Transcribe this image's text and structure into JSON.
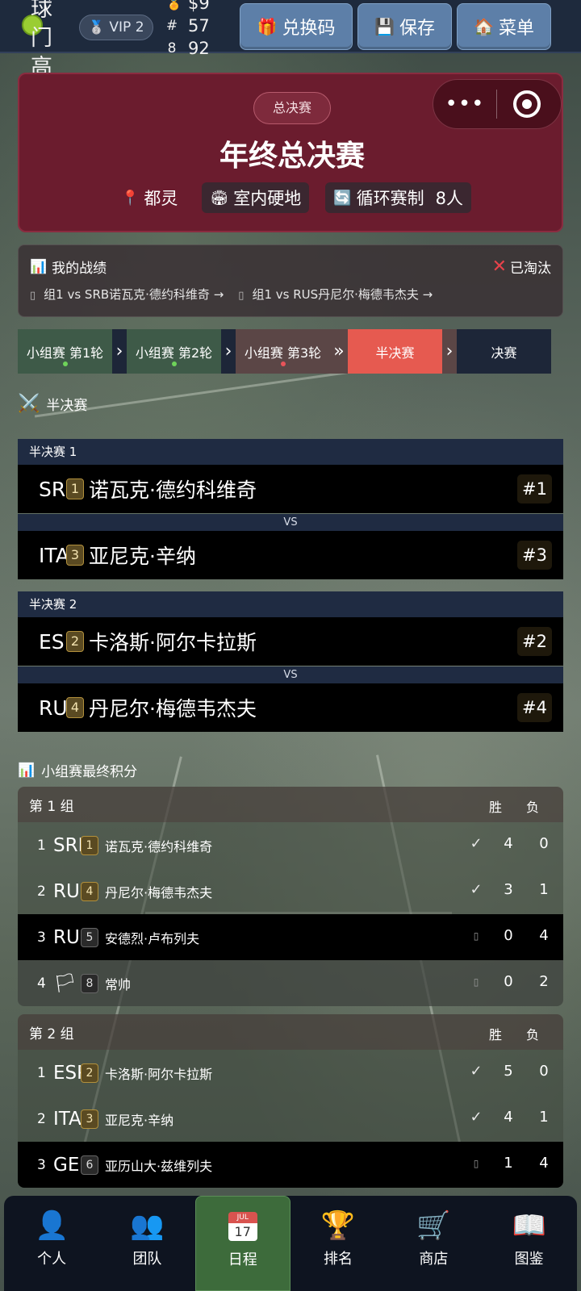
{
  "topbar": {
    "logo_text": "球\n门\n高",
    "vip_label": "VIP 2",
    "stats": [
      {
        "icon": "$",
        "value": "$9"
      },
      {
        "icon": "#",
        "value": "57"
      },
      {
        "icon": "8",
        "value": "92"
      }
    ],
    "buttons": [
      {
        "label": "兑换码",
        "icon": "gift-icon"
      },
      {
        "label": "保存",
        "icon": "floppy-disk-icon"
      },
      {
        "label": "菜单",
        "icon": "house-icon"
      }
    ]
  },
  "hero": {
    "badge": "总决赛",
    "title": "年终总决赛",
    "location": "都灵",
    "surface": "室内硬地",
    "format": "循环赛制",
    "players": "8人",
    "capsule_more": "•••"
  },
  "record": {
    "title": "我的战绩",
    "status": "已淘汰",
    "links": [
      {
        "glyph": "▯",
        "text": "组1 vs SRB诺瓦克·德约科维奇 →"
      },
      {
        "glyph": "▯",
        "text": "组1 vs RUS丹尼尔·梅德韦杰夫 →"
      }
    ]
  },
  "tabs": [
    {
      "label": "小组赛 第1轮",
      "state": "done",
      "dot": "#6fd35a"
    },
    {
      "label": "小组赛 第2轮",
      "state": "done",
      "dot": "#6fd35a"
    },
    {
      "label": "小组赛 第3轮",
      "state": "lost",
      "dot": "#e8545a"
    },
    {
      "label": "半决赛",
      "state": "active"
    },
    {
      "label": "决赛",
      "state": "future"
    }
  ],
  "tab_arrows": [
    "›",
    "›",
    "»",
    "›"
  ],
  "semifinals": {
    "title": "半决赛",
    "matches": [
      {
        "label": "半决赛 1",
        "p1": {
          "flag": "SRB",
          "seed": "1",
          "name": "诺瓦克·德约科维奇",
          "rank": "#1"
        },
        "vs": "VS",
        "p2": {
          "flag": "ITA",
          "seed": "3",
          "name": "亚尼克·辛纳",
          "rank": "#3"
        }
      },
      {
        "label": "半决赛 2",
        "p1": {
          "flag": "ESP",
          "seed": "2",
          "name": "卡洛斯·阿尔卡拉斯",
          "rank": "#2"
        },
        "vs": "VS",
        "p2": {
          "flag": "RUS",
          "seed": "4",
          "name": "丹尼尔·梅德韦杰夫",
          "rank": "#4"
        }
      }
    ]
  },
  "standings": {
    "title": "小组赛最终积分",
    "win_label": "胜",
    "loss_label": "负",
    "groups": [
      {
        "name": "第 1 组",
        "rows": [
          {
            "pos": "1",
            "flag": "SRB",
            "seed": "1",
            "name": "诺瓦克·德约科维奇",
            "mark": "✓",
            "w": "4",
            "l": "0",
            "state": "qual"
          },
          {
            "pos": "2",
            "flag": "RUS",
            "seed": "4",
            "name": "丹尼尔·梅德韦杰夫",
            "mark": "✓",
            "w": "3",
            "l": "1",
            "state": "qual"
          },
          {
            "pos": "3",
            "flag": "RUS",
            "seed": "5",
            "name": "安德烈·卢布列夫",
            "mark": "▯",
            "w": "0",
            "l": "4",
            "state": "out"
          },
          {
            "pos": "4",
            "flag": "🏳",
            "seed": "8",
            "name": "常帅",
            "mark": "▯",
            "w": "0",
            "l": "2",
            "state": "other"
          }
        ]
      },
      {
        "name": "第 2 组",
        "rows": [
          {
            "pos": "1",
            "flag": "ESP",
            "seed": "2",
            "name": "卡洛斯·阿尔卡拉斯",
            "mark": "✓",
            "w": "5",
            "l": "0",
            "state": "qual"
          },
          {
            "pos": "2",
            "flag": "ITA",
            "seed": "3",
            "name": "亚尼克·辛纳",
            "mark": "✓",
            "w": "4",
            "l": "1",
            "state": "qual"
          },
          {
            "pos": "3",
            "flag": "GER",
            "seed": "6",
            "name": "亚历山大·兹维列夫",
            "mark": "▯",
            "w": "1",
            "l": "4",
            "state": "out"
          }
        ]
      }
    ]
  },
  "nav": [
    {
      "label": "个人",
      "icon": "person-icon"
    },
    {
      "label": "团队",
      "icon": "team-icon"
    },
    {
      "label": "日程",
      "icon": "calendar-icon",
      "calendar_month": "JUL",
      "calendar_day": "17"
    },
    {
      "label": "排名",
      "icon": "trophy-icon"
    },
    {
      "label": "商店",
      "icon": "cart-icon"
    },
    {
      "label": "图鉴",
      "icon": "book-icon"
    }
  ],
  "colors": {
    "hero_bg": "#6b1c2e",
    "active_tab": "#e65a50",
    "nav_active": "#3d6b3b",
    "top_button": "#5d7fa8"
  }
}
